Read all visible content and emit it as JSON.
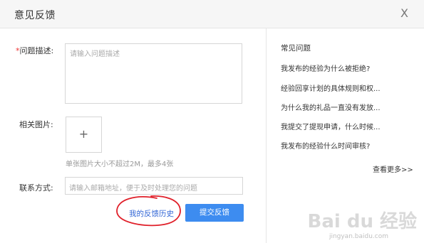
{
  "dialog": {
    "title": "意见反馈",
    "close_label": "X"
  },
  "form": {
    "description": {
      "required_mark": "*",
      "label": "问题描述:",
      "placeholder": "请输入问题描述"
    },
    "images": {
      "label": "相关图片:",
      "add_icon": "+",
      "hint": "单张图片大小不超过2M，最多4张"
    },
    "contact": {
      "label": "联系方式:",
      "placeholder": "请输入邮箱地址，便于及时处理您的问题"
    },
    "history_link": "我的反馈历史",
    "submit_label": "提交反馈"
  },
  "faq": {
    "title": "常见问题",
    "items": [
      "我发布的经验为什么被拒绝?",
      "经验回享计划的具体规则和权...",
      "为什么我的礼品一直没有发放...",
      "我提交了提现申请，什么时候...",
      "我发布的经验什么时间审核?"
    ],
    "more_label": "查看更多>>"
  },
  "watermark": {
    "text": "Bai du 经验",
    "sub": "jingyan.baidu.com"
  },
  "colors": {
    "accent": "#3d8cf0",
    "link": "#3367d6",
    "annotation": "#e0202a"
  }
}
